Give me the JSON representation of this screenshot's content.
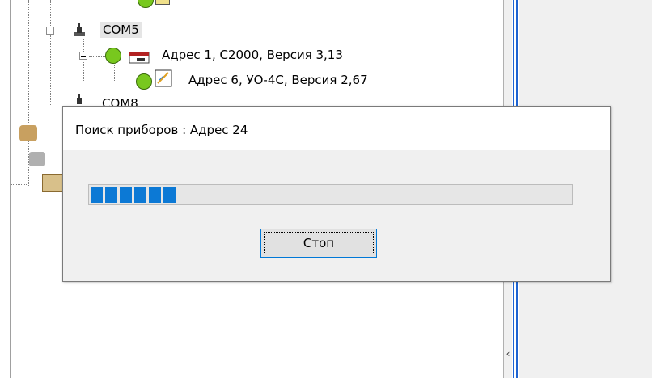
{
  "tree": {
    "items": [
      {
        "label": "COM5",
        "icon": "port-icon"
      },
      {
        "label": "Адрес 1, С2000, Версия 3,13",
        "icon": "device-icon"
      },
      {
        "label": "Адрес 6, УО-4С, Версия 2,67",
        "icon": "device-icon"
      },
      {
        "label": "COM8",
        "icon": "port-icon"
      }
    ]
  },
  "dialog": {
    "title": "Поиск приборов : Адрес 24",
    "progress": {
      "filled_segments": 6,
      "accent": "#0c79d5"
    },
    "stop_label": "Стоп"
  },
  "colors": {
    "accent_blue": "#1e64d2",
    "node_green": "#78c81e",
    "button_focus_border": "#0078d7"
  }
}
